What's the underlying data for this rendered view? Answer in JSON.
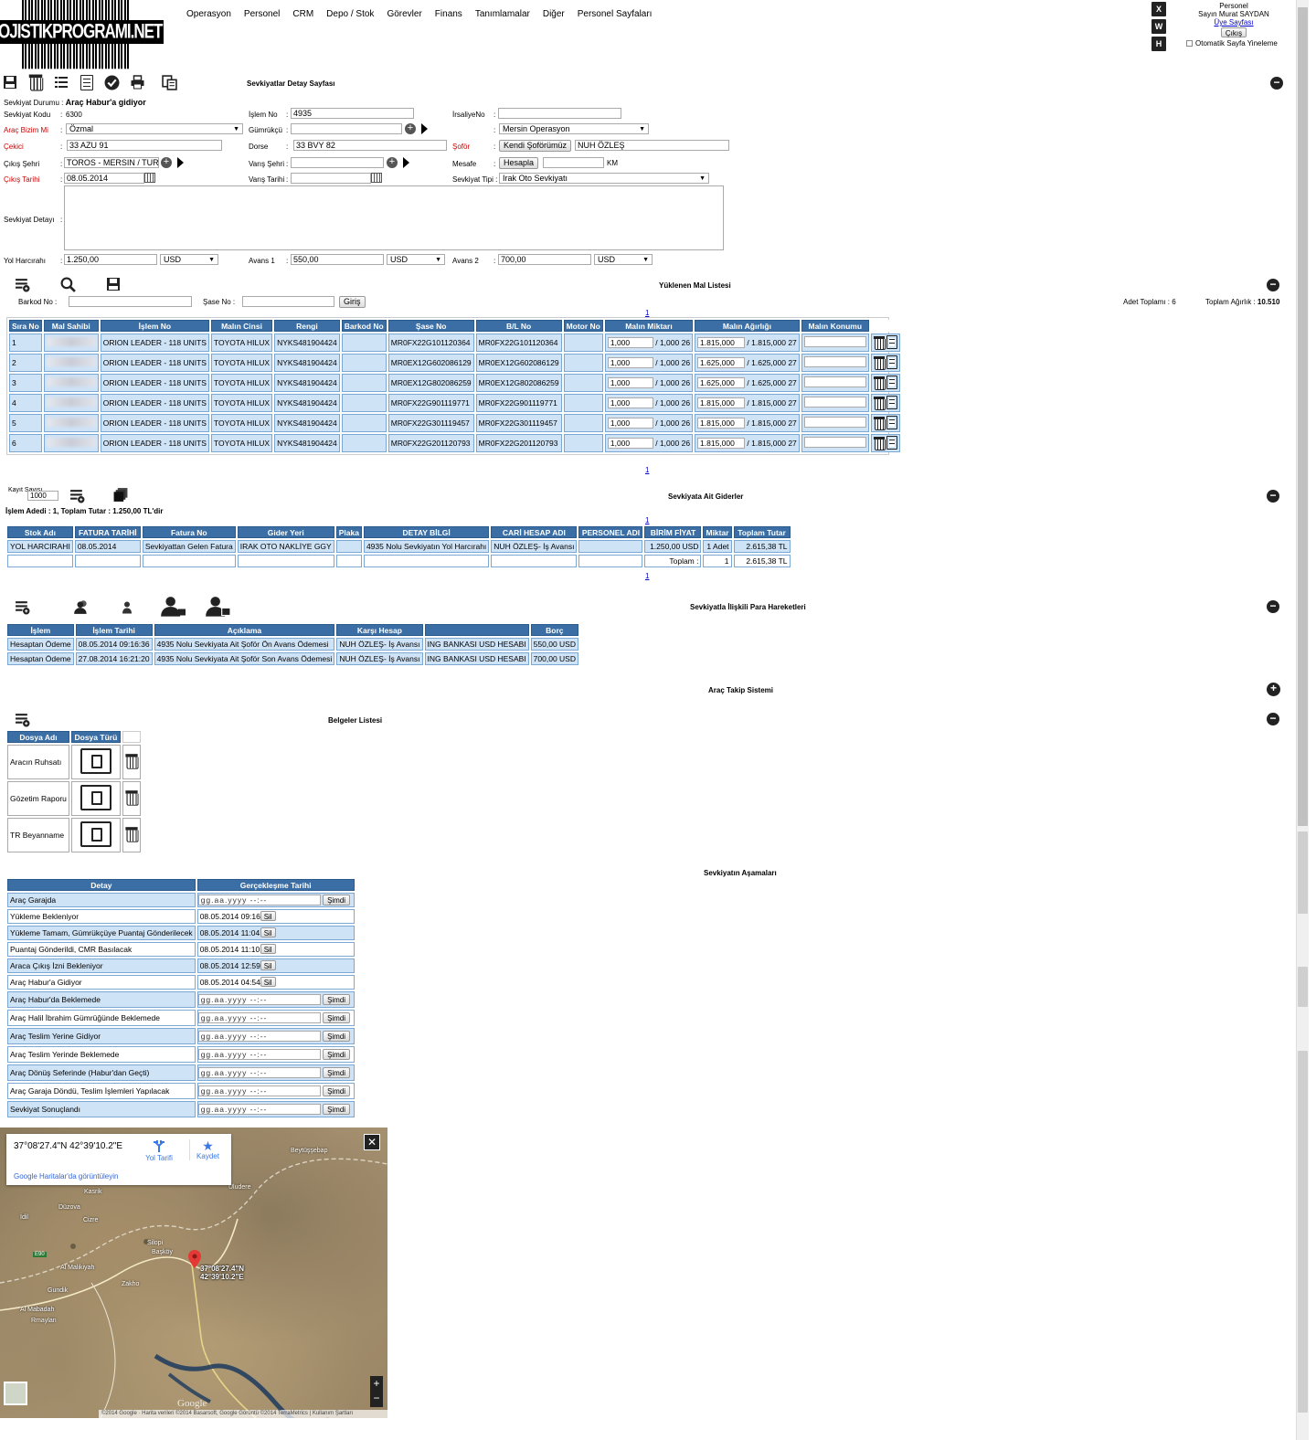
{
  "header": {
    "logo_text": "LOJISTIKPROGRAMI.NET",
    "menu": [
      "Operasyon",
      "Personel",
      "CRM",
      "Depo / Stok",
      "Görevler",
      "Finans",
      "Tanımlamalar",
      "Diğer",
      "Personel Sayfaları"
    ],
    "export_icons": [
      "X",
      "W",
      "H"
    ],
    "user": {
      "role": "Personel",
      "greeting": "Sayın Murat SAYDAN",
      "profile_link": "Üye Sayfası",
      "logout": "Çıkış",
      "auto_refresh": "Otomatik Sayfa Yineleme"
    }
  },
  "detail": {
    "title": "Sevkiyatlar Detay Sayfası",
    "status_label": "Sevkiyat Durumu :",
    "status_value": "Araç Habur'a gidiyor",
    "code_label": "Sevkiyat Kodu",
    "code_value": "6300",
    "own_vehicle_label": "Araç Bizim Mi",
    "own_vehicle_value": "Özmal",
    "truck_label": "Çekici",
    "truck_value": "33 AZU 91",
    "from_city_label": "Çıkış Şehri",
    "from_city_value": "TOROS - MERSIN / TUR",
    "departure_label": "Çıkış Tarihi",
    "departure_value": "08.05.2014",
    "job_label": "İşlem No",
    "job_value": "4935",
    "customs_label": "Gümrükçü",
    "customs_value": "",
    "trailer_label": "Dorse",
    "trailer_value": "33 BVY 82",
    "to_city_label": "Varış Şehri",
    "to_city_value": "",
    "arrival_label": "Varış Tarihi",
    "arrival_value": "",
    "waybill_label": "İrsaliyeNo",
    "waybill_value": "",
    "office_value": "Mersin Operasyon",
    "driver_label": "Şoför",
    "driver_btn": "Kendi Şoförümüz",
    "driver_value": "NUH ÖZLEŞ",
    "distance_label": "Mesafe",
    "distance_btn": "Hesapla",
    "distance_value": "",
    "distance_unit": "KM",
    "type_label": "Sevkiyat Tipi :",
    "type_value": "Irak Oto Sevkiyatı",
    "notes_label": "Sevkiyat Detayı",
    "notes_value": "",
    "road_label": "Yol Harcırahı",
    "road_value": "1.250,00",
    "road_cur": "USD",
    "adv1_label": "Avans 1",
    "adv1_value": "550,00",
    "adv1_cur": "USD",
    "adv2_label": "Avans 2",
    "adv2_value": "700,00",
    "adv2_cur": "USD"
  },
  "cargo": {
    "title": "Yüklenen Mal Listesi",
    "barcode_label": "Barkod No :",
    "chassis_label": "Şase No :",
    "enter_btn": "Giriş",
    "qty_total": "Adet Toplamı : 6",
    "weight_total_label": "Toplam Ağırlık :",
    "weight_total": "10.510",
    "page": "1",
    "columns": [
      "Sıra No",
      "Mal Sahibi",
      "İşlem No",
      "Malın Cinsi",
      "Rengi",
      "Barkod No",
      "Şase No",
      "B/L No",
      "Motor No",
      "Malın Miktarı",
      "Malın Ağırlığı",
      "Malın Konumu"
    ],
    "rows": [
      {
        "no": "1",
        "job": "ORION LEADER - 118 UNITS",
        "kind": "TOYOTA HILUX",
        "color": "NYKS481904424",
        "barcode": "",
        "chassis": "MR0FX22G101120364",
        "bl": "MR0FX22G101120364",
        "motor": "",
        "qty": "1,000",
        "qty_of": "/ 1,000 26",
        "wt": "1.815,000",
        "wt_of": "/ 1.815,000 27",
        "loc": ""
      },
      {
        "no": "2",
        "job": "ORION LEADER - 118 UNITS",
        "kind": "TOYOTA HILUX",
        "color": "NYKS481904424",
        "barcode": "",
        "chassis": "MR0EX12G602086129",
        "bl": "MR0EX12G602086129",
        "motor": "",
        "qty": "1,000",
        "qty_of": "/ 1,000 26",
        "wt": "1.625,000",
        "wt_of": "/ 1.625,000 27",
        "loc": ""
      },
      {
        "no": "3",
        "job": "ORION LEADER - 118 UNITS",
        "kind": "TOYOTA HILUX",
        "color": "NYKS481904424",
        "barcode": "",
        "chassis": "MR0EX12G802086259",
        "bl": "MR0EX12G802086259",
        "motor": "",
        "qty": "1,000",
        "qty_of": "/ 1,000 26",
        "wt": "1.625,000",
        "wt_of": "/ 1.625,000 27",
        "loc": ""
      },
      {
        "no": "4",
        "job": "ORION LEADER - 118 UNITS",
        "kind": "TOYOTA HILUX",
        "color": "NYKS481904424",
        "barcode": "",
        "chassis": "MR0FX22G901119771",
        "bl": "MR0FX22G901119771",
        "motor": "",
        "qty": "1,000",
        "qty_of": "/ 1,000 26",
        "wt": "1.815,000",
        "wt_of": "/ 1.815,000 27",
        "loc": ""
      },
      {
        "no": "5",
        "job": "ORION LEADER - 118 UNITS",
        "kind": "TOYOTA HILUX",
        "color": "NYKS481904424",
        "barcode": "",
        "chassis": "MR0FX22G301119457",
        "bl": "MR0FX22G301119457",
        "motor": "",
        "qty": "1,000",
        "qty_of": "/ 1,000 26",
        "wt": "1.815,000",
        "wt_of": "/ 1.815,000 27",
        "loc": ""
      },
      {
        "no": "6",
        "job": "ORION LEADER - 118 UNITS",
        "kind": "TOYOTA HILUX",
        "color": "NYKS481904424",
        "barcode": "",
        "chassis": "MR0FX22G201120793",
        "bl": "MR0FX22G201120793",
        "motor": "",
        "qty": "1,000",
        "qty_of": "/ 1,000 26",
        "wt": "1.815,000",
        "wt_of": "/ 1.815,000 27",
        "loc": ""
      }
    ]
  },
  "expenses": {
    "title": "Sevkiyata Ait Giderler",
    "record_label": "Kayıt Sayısı",
    "record_value": "1000",
    "summary": "İşlem Adedi : 1, Toplam Tutar : 1.250,00  TL'dir",
    "page": "1",
    "columns": [
      "Stok Adı",
      "FATURA TARİHİ",
      "Fatura No",
      "Gider Yeri",
      "Plaka",
      "DETAY BİLGİ",
      "CARİ HESAP ADI",
      "PERSONEL ADI",
      "BİRİM FİYAT",
      "Miktar",
      "Toplam Tutar"
    ],
    "row": [
      "YOL HARCIRAHI",
      "08.05.2014",
      "Sevkiyattan Gelen Fatura",
      "IRAK OTO NAKLİYE GGY",
      "",
      "4935 Nolu Sevkiyatın Yol Harcırahı",
      "NUH ÖZLEŞ- İş Avansı",
      "",
      "1.250,00 USD",
      "1 Adet",
      "2.615,38 TL"
    ],
    "total_label": "Toplam :",
    "total_qty": "1",
    "total_sum": "2.615,38 TL"
  },
  "money": {
    "title": "Sevkiyatla İlişkili Para Hareketleri",
    "columns": [
      "İşlem",
      "İşlem Tarihi",
      "Açıklama",
      "Karşı Hesap",
      "",
      "Borç"
    ],
    "rows": [
      [
        "Hesaptan Ödeme",
        "08.05.2014 09:16:36",
        "4935 Nolu Sevkiyata Ait Şoför Ön Avans Ödemesi",
        "NUH ÖZLEŞ- İş Avansı",
        "ING BANKASI USD HESABI",
        "550,00 USD"
      ],
      [
        "Hesaptan Ödeme",
        "27.08.2014 16:21:20",
        "4935 Nolu Sevkiyata Ait Şoför Son Avans Ödemesi",
        "NUH ÖZLEŞ- İş Avansı",
        "ING BANKASI USD HESABI",
        "700,00 USD"
      ]
    ]
  },
  "tracking": {
    "title": "Araç Takip Sistemi"
  },
  "documents": {
    "title": "Belgeler Listesi",
    "columns": [
      "Dosya Adı",
      "Dosya Türü"
    ],
    "rows": [
      "Aracın Ruhsatı",
      "Gözetim Raporu",
      "TR Beyanname"
    ]
  },
  "stages": {
    "title": "Sevkiyatın Aşamaları",
    "columns": [
      "Detay",
      "Gerçekleşme Tarihi"
    ],
    "now_btn": "Şimdi",
    "del_btn": "Sil",
    "placeholder": "gg.aa.yyyy --:--",
    "rows": [
      {
        "name": "Araç Garajda",
        "date": ""
      },
      {
        "name": "Yükleme Bekleniyor",
        "date": "08.05.2014 09:16"
      },
      {
        "name": "Yükleme Tamam, Gümrükçüye Puantaj Gönderilecek",
        "date": "08.05.2014 11:04"
      },
      {
        "name": "Puantaj Gönderildi, CMR Basılacak",
        "date": "08.05.2014 11:10"
      },
      {
        "name": "Araca Çıkış İzni Bekleniyor",
        "date": "08.05.2014 12:59"
      },
      {
        "name": "Araç Habur'a Gidiyor",
        "date": "08.05.2014 04:54"
      },
      {
        "name": "Araç Habur'da Beklemede",
        "date": ""
      },
      {
        "name": "Araç Halil İbrahim Gümrüğünde Beklemede",
        "date": ""
      },
      {
        "name": "Araç Teslim Yerine Gidiyor",
        "date": ""
      },
      {
        "name": "Araç Teslim Yerinde Beklemede",
        "date": ""
      },
      {
        "name": "Araç Dönüş Seferinde (Habur'dan Geçti)",
        "date": ""
      },
      {
        "name": "Araç Garaja Döndü, Teslim İşlemleri Yapılacak",
        "date": ""
      },
      {
        "name": "Sevkiyat Sonuçlandı",
        "date": ""
      }
    ]
  },
  "map": {
    "coords": "37°08'27.4\"N 42°39'10.2\"E",
    "directions": "Yol Tarifi",
    "save": "Kaydet",
    "open_link": "Google Haritalar'da görüntüleyin",
    "pin_label_1": "37°08'27.4\"N",
    "pin_label_2": "42°39'10.2\"E",
    "places": [
      "Beytüşşebap",
      "Uludere",
      "Kasrik",
      "Cizre",
      "Silopi",
      "Başköy",
      "İdil",
      "Düzova",
      "Al Malikiyah",
      "Zakho",
      "Rmaylan",
      "Al Mabadah",
      "Gundik",
      "E90"
    ],
    "watermark": "Google",
    "copyright": "©2014 Google · Harita verileri ©2014 Basarsoft, Google Görüntü ©2014 TerraMetrics  |  Kullanım Şartları",
    "zoom_in": "+",
    "zoom_out": "−"
  }
}
